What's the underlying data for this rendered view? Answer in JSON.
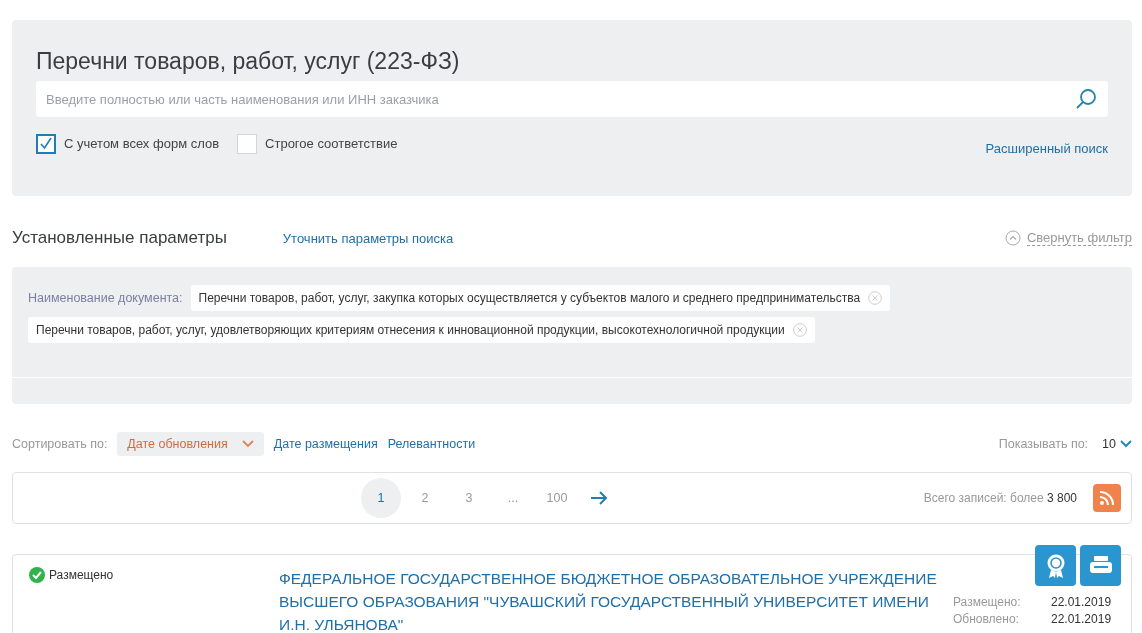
{
  "search": {
    "title": "Перечни товаров, работ, услуг (223-ФЗ)",
    "placeholder": "Введите полностью или часть наименования или ИНН заказчика",
    "options": [
      {
        "label": "С учетом всех форм слов",
        "checked": true
      },
      {
        "label": "Строгое соответствие",
        "checked": false
      }
    ],
    "advanced_link": "Расширенный поиск"
  },
  "params": {
    "title": "Установленные параметры",
    "refine_link": "Уточнить параметры поиска",
    "collapse_link": "Свернуть фильтр",
    "filter_label": "Наименование документа:",
    "tags": [
      "Перечни товаров, работ, услуг, закупка которых осуществляется у субъектов малого и среднего предпринимательства",
      "Перечни товаров, работ, услуг, удовлетворяющих критериям отнесения к инновационной продукции, высокотехнологичной продукции"
    ]
  },
  "sort": {
    "label": "Сортировать по:",
    "options": [
      {
        "label": "Дате обновления",
        "selected": true
      },
      {
        "label": "Дате размещения",
        "selected": false
      },
      {
        "label": "Релевантности",
        "selected": false
      }
    ],
    "page_size_label": "Показывать по:",
    "page_size": "10"
  },
  "pagination": {
    "pages": [
      {
        "label": "1",
        "selected": true
      },
      {
        "label": "2",
        "selected": false
      },
      {
        "label": "3",
        "selected": false
      },
      {
        "label": "...",
        "selected": false
      },
      {
        "label": "100",
        "selected": false
      }
    ],
    "total": "Всего записей: более **3 800**"
  },
  "results": [
    {
      "status": "Размещено",
      "title": "ФЕДЕРАЛЬНОЕ ГОСУДАРСТВЕННОЕ БЮДЖЕТНОЕ ОБРАЗОВАТЕЛЬНОЕ УЧРЕЖДЕНИЕ ВЫСШЕГО ОБРАЗОВАНИЯ \"ЧУВАШСКИЙ ГОСУДАРСТВЕННЫЙ УНИВЕРСИТЕТ ИМЕНИ И.Н. УЛЬЯНОВА\"",
      "dates": [
        {
          "label": "Размещено:",
          "value": "22.01.2019"
        },
        {
          "label": "Обновлено:",
          "value": "22.01.2019"
        }
      ]
    }
  ]
}
